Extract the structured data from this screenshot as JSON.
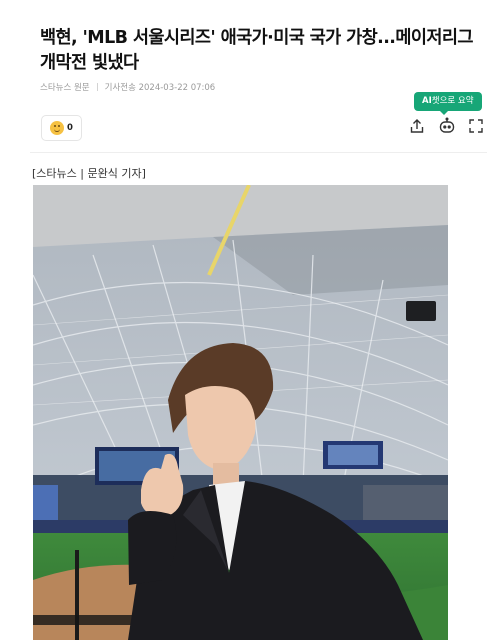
{
  "article": {
    "headline": "백현, 'MLB 서울시리즈' 애국가·미국 국가 가창...메이저리그 개막전 빛냈다",
    "source": "스타뉴스 원문",
    "sent_label": "기사전송",
    "datetime": "2024-03-22 07:06",
    "caption": "[스타뉴스 | 문완식 기자]"
  },
  "ai_summary": {
    "ai": "AI",
    "label": "챗으로 요약"
  },
  "reaction": {
    "icon": "smile-emoji-icon",
    "count": "0"
  },
  "toolbar": [
    {
      "name": "share-icon"
    },
    {
      "name": "chatbot-icon"
    },
    {
      "name": "expand-icon"
    }
  ],
  "colors": {
    "ai_badge": "#17a677",
    "headline": "#111111",
    "meta": "#9a9a9a"
  }
}
